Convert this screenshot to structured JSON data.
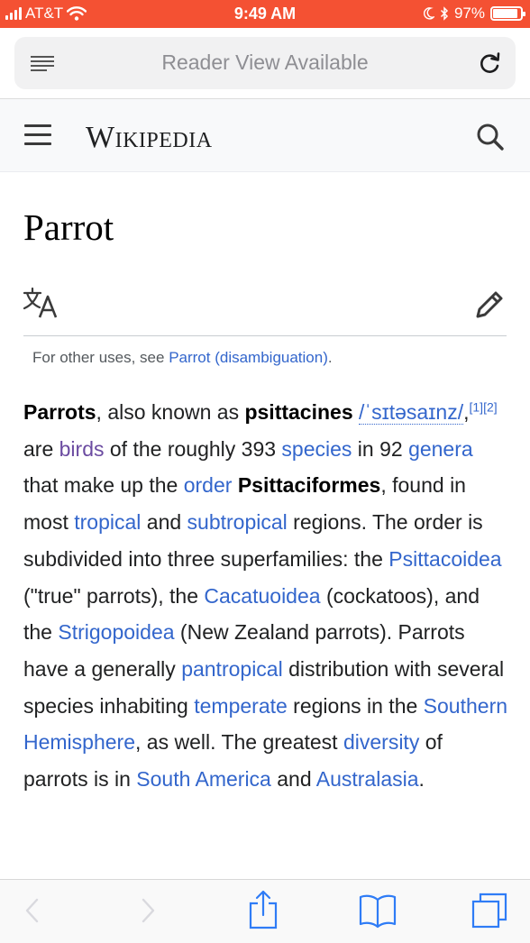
{
  "status_bar": {
    "carrier": "AT&T",
    "time": "9:49 AM",
    "battery": "97%",
    "battery_level": 0.97
  },
  "url_bar": {
    "text": "Reader View Available"
  },
  "wiki_header": {
    "logo": "Wikipedia"
  },
  "page": {
    "title": "Parrot",
    "hatnote_prefix": "For other uses, see ",
    "hatnote_link": "Parrot (disambiguation)",
    "hatnote_suffix": "."
  },
  "article": {
    "s1": "Parrots",
    "s2": ", also known as ",
    "s3": "psittacines",
    "s4": "/ˈsɪtəsaɪnz/",
    "s5": ",",
    "s6": "[1]",
    "s7": "[2]",
    "s8": " are ",
    "s9": "birds",
    "s10": " of the roughly 393 ",
    "s11": "species",
    "s12": " in 92 ",
    "s13": "genera",
    "s14": " that make up the ",
    "s15": "order",
    "s16": "Psittaciformes",
    "s17": ", found in most ",
    "s18": "tropical",
    "s19": " and ",
    "s20": "subtropical",
    "s21": " regions. The order is subdivided into three superfamilies: the ",
    "s22": "Psittacoidea",
    "s23": " (\"true\" parrots), the ",
    "s24": "Cacatuoidea",
    "s25": " (cockatoos), and the ",
    "s26": "Strigopoidea",
    "s27": " (New Zealand parrots). Parrots have a generally ",
    "s28": "pantropical",
    "s29": " distribution with several species inhabiting ",
    "s30": "temperate",
    "s31": " regions in the ",
    "s32": "Southern Hemisphere",
    "s33": ", as well. The greatest ",
    "s34": "diversity",
    "s35": " of parrots is in ",
    "s36": "South America",
    "s37": " and ",
    "s38": "Australasia",
    "s39": "."
  },
  "icons": {
    "menu": "hamburger-icon",
    "search": "search-icon",
    "language": "translate-icon",
    "edit": "pencil-icon",
    "back": "chevron-left-icon",
    "forward": "chevron-right-icon",
    "share": "share-icon",
    "bookmarks": "book-icon",
    "tabs": "tabs-icon"
  },
  "colors": {
    "status_bar": "#f45133",
    "link": "#3366cc",
    "visited_link": "#6b4ba1",
    "toolbar_icon": "#2f7cf6"
  }
}
